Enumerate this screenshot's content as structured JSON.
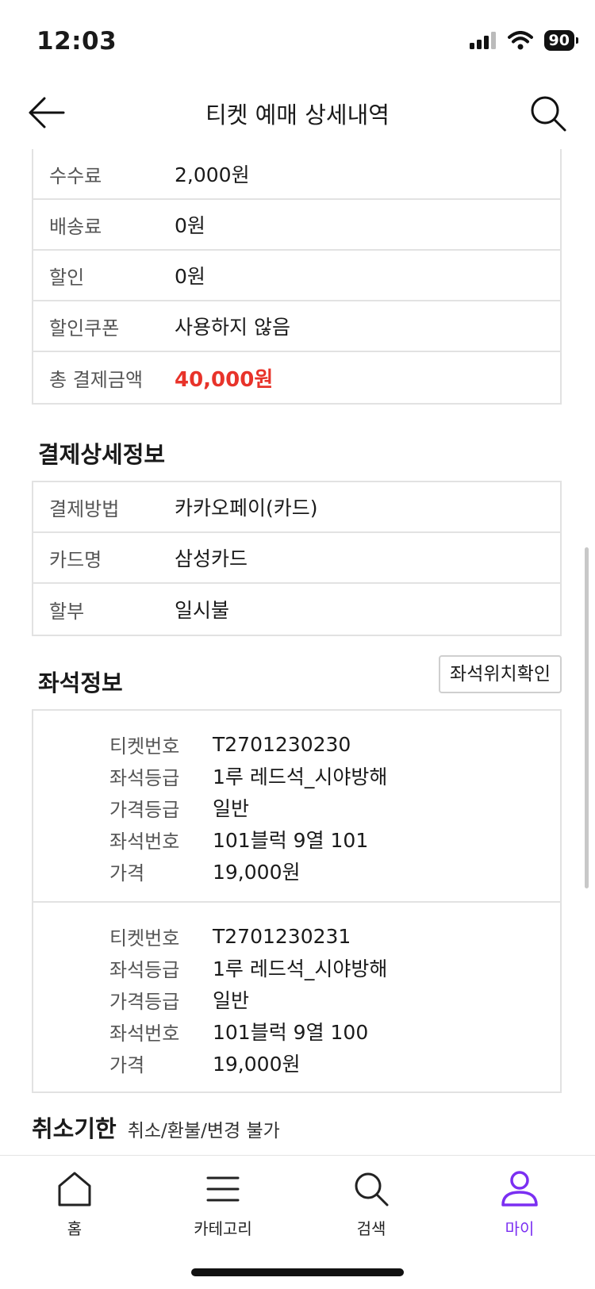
{
  "status_bar": {
    "time": "12:03",
    "battery": "90"
  },
  "header": {
    "title": "티켓 예매 상세내역"
  },
  "payment_summary": [
    {
      "label": "수수료",
      "value": "2,000원"
    },
    {
      "label": "배송료",
      "value": "0원"
    },
    {
      "label": "할인",
      "value": "0원"
    },
    {
      "label": "할인쿠폰",
      "value": "사용하지 않음"
    },
    {
      "label": "총 결제금액",
      "value": "40,000원"
    }
  ],
  "payment_detail": {
    "title": "결제상세정보",
    "rows": [
      {
        "label": "결제방법",
        "value": "카카오페이(카드)"
      },
      {
        "label": "카드명",
        "value": "삼성카드"
      },
      {
        "label": "할부",
        "value": "일시불"
      }
    ]
  },
  "seat_info": {
    "title": "좌석정보",
    "check_button": "좌석위치확인",
    "labels": {
      "ticket_no": "티켓번호",
      "seat_grade": "좌석등급",
      "price_grade": "가격등급",
      "seat_no": "좌석번호",
      "price": "가격"
    },
    "tickets": [
      {
        "ticket_no": "T2701230230",
        "seat_grade": "1루 레드석_시야방해",
        "price_grade": "일반",
        "seat_no": "101블럭 9열 101",
        "price": "19,000원"
      },
      {
        "ticket_no": "T2701230231",
        "seat_grade": "1루 레드석_시야방해",
        "price_grade": "일반",
        "seat_no": "101블럭 9열 100",
        "price": "19,000원"
      }
    ]
  },
  "cancel": {
    "title": "취소기한",
    "value": "취소/환불/변경 불가"
  },
  "bottom_nav": [
    {
      "label": "홈",
      "icon": "home-icon"
    },
    {
      "label": "카테고리",
      "icon": "menu-icon"
    },
    {
      "label": "검색",
      "icon": "search-icon"
    },
    {
      "label": "마이",
      "icon": "user-icon"
    }
  ],
  "colors": {
    "accent": "#7b2ff2",
    "total_amount": "#e8332a",
    "border": "#e2e2e2"
  }
}
